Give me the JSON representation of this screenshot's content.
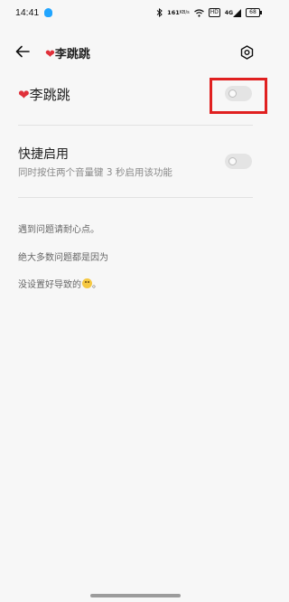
{
  "status_bar": {
    "time": "14:41",
    "network_speed_top": "161",
    "network_speed_bottom": "KB/s",
    "hd_label": "HD",
    "signal_label": "4G",
    "battery_level": "68"
  },
  "header": {
    "title_heart": "❤",
    "title": "李跳跳"
  },
  "main_toggle": {
    "heart": "❤",
    "label": "李跳跳",
    "enabled": false
  },
  "quick_start": {
    "label": "快捷启用",
    "description": "同时按住两个音量键 3 秒启用该功能",
    "enabled": false
  },
  "notes": {
    "line1": "遇到问题请耐心点。",
    "line2": "绝大多数问题都是因为",
    "line3_text": "没设置好导致的",
    "line3_end": "。"
  },
  "colors": {
    "highlight_border": "#e02020",
    "heart": "#e0303a",
    "qq_icon": "#21a5ff"
  }
}
